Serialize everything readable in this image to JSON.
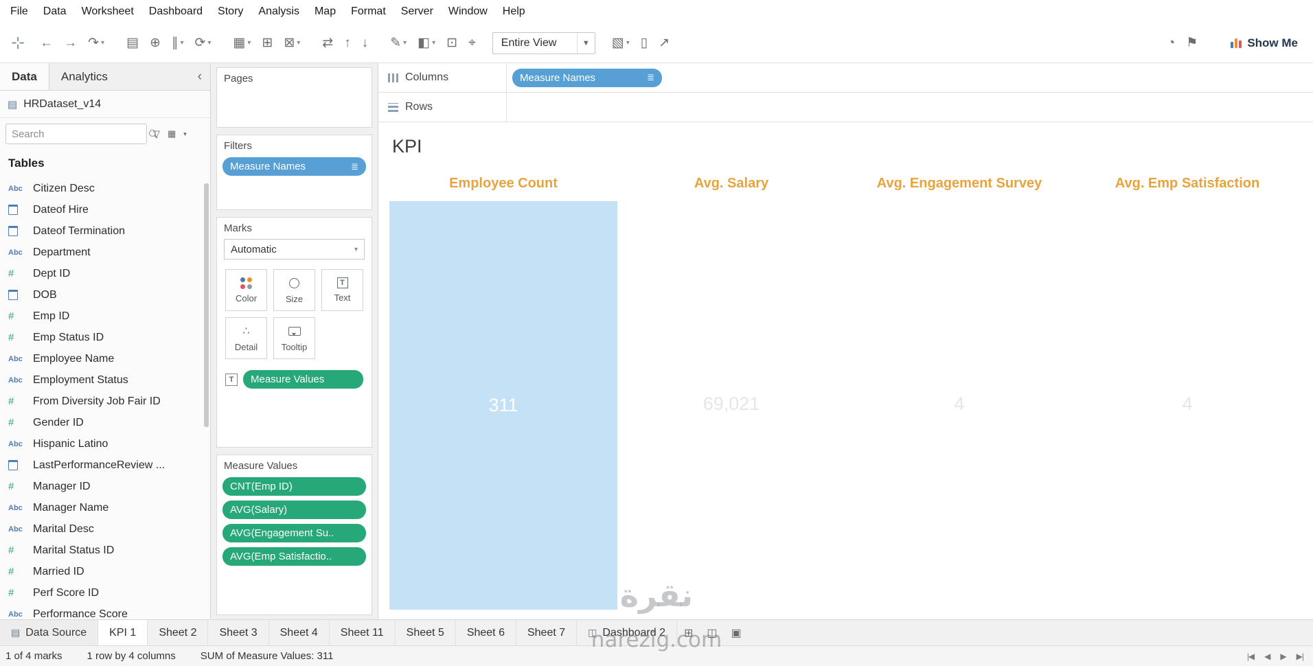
{
  "colors": {
    "pill-blue": "#57a0d6",
    "pill-green": "#26a879",
    "header-gold": "#e8a33d",
    "bar-blue": "#c5e1f6"
  },
  "menu": {
    "items": [
      "File",
      "Data",
      "Worksheet",
      "Dashboard",
      "Story",
      "Analysis",
      "Map",
      "Format",
      "Server",
      "Window",
      "Help"
    ]
  },
  "toolbar": {
    "fit_value": "Entire View",
    "show_me_label": "Show Me",
    "buttons_left": [
      {
        "name": "back",
        "glyph": "←"
      },
      {
        "name": "forward",
        "glyph": "→"
      },
      {
        "name": "undo-redo",
        "glyph": "↷",
        "caret": true
      },
      {
        "name": "save",
        "glyph": "▤",
        "sp": true
      },
      {
        "name": "add-data-source",
        "glyph": "⊕"
      },
      {
        "name": "pause-auto-updates",
        "glyph": "∥",
        "caret": true
      },
      {
        "name": "refresh-data",
        "glyph": "⟳",
        "caret": true
      },
      {
        "name": "new-worksheet",
        "glyph": "▦",
        "caret": true,
        "sp": true
      },
      {
        "name": "duplicate-sheet",
        "glyph": "⊞"
      },
      {
        "name": "clear-sheet",
        "glyph": "⊠",
        "caret": true
      },
      {
        "name": "swap-rows-columns",
        "glyph": "⇄",
        "sp": true
      },
      {
        "name": "sort-ascending",
        "glyph": "↑"
      },
      {
        "name": "sort-descending",
        "glyph": "↓"
      },
      {
        "name": "highlight",
        "glyph": "✎",
        "caret": true,
        "sp": true
      },
      {
        "name": "mark-labels",
        "glyph": "◧",
        "caret": true
      },
      {
        "name": "fix-axes",
        "glyph": "⊡"
      },
      {
        "name": "pin",
        "glyph": "⌖"
      }
    ],
    "buttons_right": [
      {
        "name": "show-hide-cards",
        "glyph": "▧",
        "caret": true
      },
      {
        "name": "presentation-mode",
        "glyph": "▯"
      },
      {
        "name": "share-workbook",
        "glyph": "↗"
      }
    ],
    "buttons_far_right": [
      {
        "name": "notifications",
        "glyph": "◔"
      },
      {
        "name": "flag",
        "glyph": "⚑"
      }
    ]
  },
  "sidebar": {
    "tabs": {
      "data": "Data",
      "analytics": "Analytics"
    },
    "collapse_glyph": "‹",
    "datasource_name": "HRDataset_v14",
    "search_placeholder": "Search",
    "tables_header": "Tables",
    "fields": [
      {
        "type": "abc",
        "name": "Citizen Desc"
      },
      {
        "type": "date",
        "name": "Dateof Hire"
      },
      {
        "type": "date",
        "name": "Dateof Termination"
      },
      {
        "type": "abc",
        "name": "Department"
      },
      {
        "type": "num",
        "name": "Dept ID"
      },
      {
        "type": "date",
        "name": "DOB"
      },
      {
        "type": "num",
        "name": "Emp ID"
      },
      {
        "type": "num",
        "name": "Emp Status ID"
      },
      {
        "type": "abc",
        "name": "Employee Name"
      },
      {
        "type": "abc",
        "name": "Employment Status"
      },
      {
        "type": "num",
        "name": "From Diversity Job Fair ID"
      },
      {
        "type": "num",
        "name": "Gender ID"
      },
      {
        "type": "abc",
        "name": "Hispanic Latino"
      },
      {
        "type": "date",
        "name": "LastPerformanceReview ..."
      },
      {
        "type": "num",
        "name": "Manager ID"
      },
      {
        "type": "abc",
        "name": "Manager Name"
      },
      {
        "type": "abc",
        "name": "Marital Desc"
      },
      {
        "type": "num",
        "name": "Marital Status ID"
      },
      {
        "type": "num",
        "name": "Married ID"
      },
      {
        "type": "num",
        "name": "Perf Score ID"
      },
      {
        "type": "abc",
        "name": "Performance Score"
      }
    ]
  },
  "cards": {
    "pages": {
      "title": "Pages"
    },
    "filters": {
      "title": "Filters",
      "pills": [
        {
          "label": "Measure Names",
          "color": "blue",
          "menu_icon": "≣"
        }
      ]
    },
    "marks": {
      "title": "Marks",
      "mark_type": "Automatic",
      "buttons": [
        {
          "id": "color",
          "label": "Color"
        },
        {
          "id": "size",
          "label": "Size"
        },
        {
          "id": "text",
          "label": "Text"
        },
        {
          "id": "detail",
          "label": "Detail"
        },
        {
          "id": "tooltip",
          "label": "Tooltip"
        }
      ],
      "pill_label": "Measure Values"
    },
    "measure_values": {
      "title": "Measure Values",
      "pills": [
        "CNT(Emp ID)",
        "AVG(Salary)",
        "AVG(Engagement Su..",
        "AVG(Emp Satisfactio.."
      ]
    }
  },
  "shelves": {
    "columns_label": "Columns",
    "rows_label": "Rows",
    "columns_pills": [
      {
        "label": "Measure Names",
        "color": "blue",
        "menu_icon": "≣"
      }
    ]
  },
  "canvas": {
    "title": "KPI"
  },
  "watermark": {
    "line1": "نقرة",
    "line2": "narezig.com"
  },
  "chart_data": {
    "type": "bar",
    "title": "KPI",
    "categories": [
      "Employee Count",
      "Avg. Salary",
      "Avg. Engagement Survey",
      "Avg. Emp Satisfaction"
    ],
    "values": [
      311,
      69021,
      4,
      4
    ],
    "value_labels": [
      "311",
      "69,021",
      "4",
      "4"
    ],
    "selected_index": 0,
    "legend_position": "none",
    "grid": false
  },
  "sheet_tabs": {
    "tabs": [
      {
        "label": "Data Source",
        "icon": "datasource"
      },
      {
        "label": "KPI 1",
        "active": true
      },
      {
        "label": "Sheet 2"
      },
      {
        "label": "Sheet 3"
      },
      {
        "label": "Sheet 4"
      },
      {
        "label": "Sheet 11"
      },
      {
        "label": "Sheet 5"
      },
      {
        "label": "Sheet 6"
      },
      {
        "label": "Sheet 7"
      },
      {
        "label": "Dashboard 2",
        "icon": "dashboard"
      }
    ],
    "new_buttons": [
      {
        "name": "new-worksheet-tab",
        "glyph": "⊞"
      },
      {
        "name": "new-dashboard-tab",
        "glyph": "◫"
      },
      {
        "name": "new-story-tab",
        "glyph": "▣"
      }
    ]
  },
  "status_bar": {
    "marks": "1 of 4 marks",
    "dims": "1 row by 4 columns",
    "agg": "SUM of Measure Values: 311",
    "nav": [
      {
        "name": "first-sheet",
        "glyph": "|◀"
      },
      {
        "name": "prev-sheet",
        "glyph": "◀"
      },
      {
        "name": "next-sheet",
        "glyph": "▶"
      },
      {
        "name": "last-sheet",
        "glyph": "▶|"
      }
    ]
  }
}
